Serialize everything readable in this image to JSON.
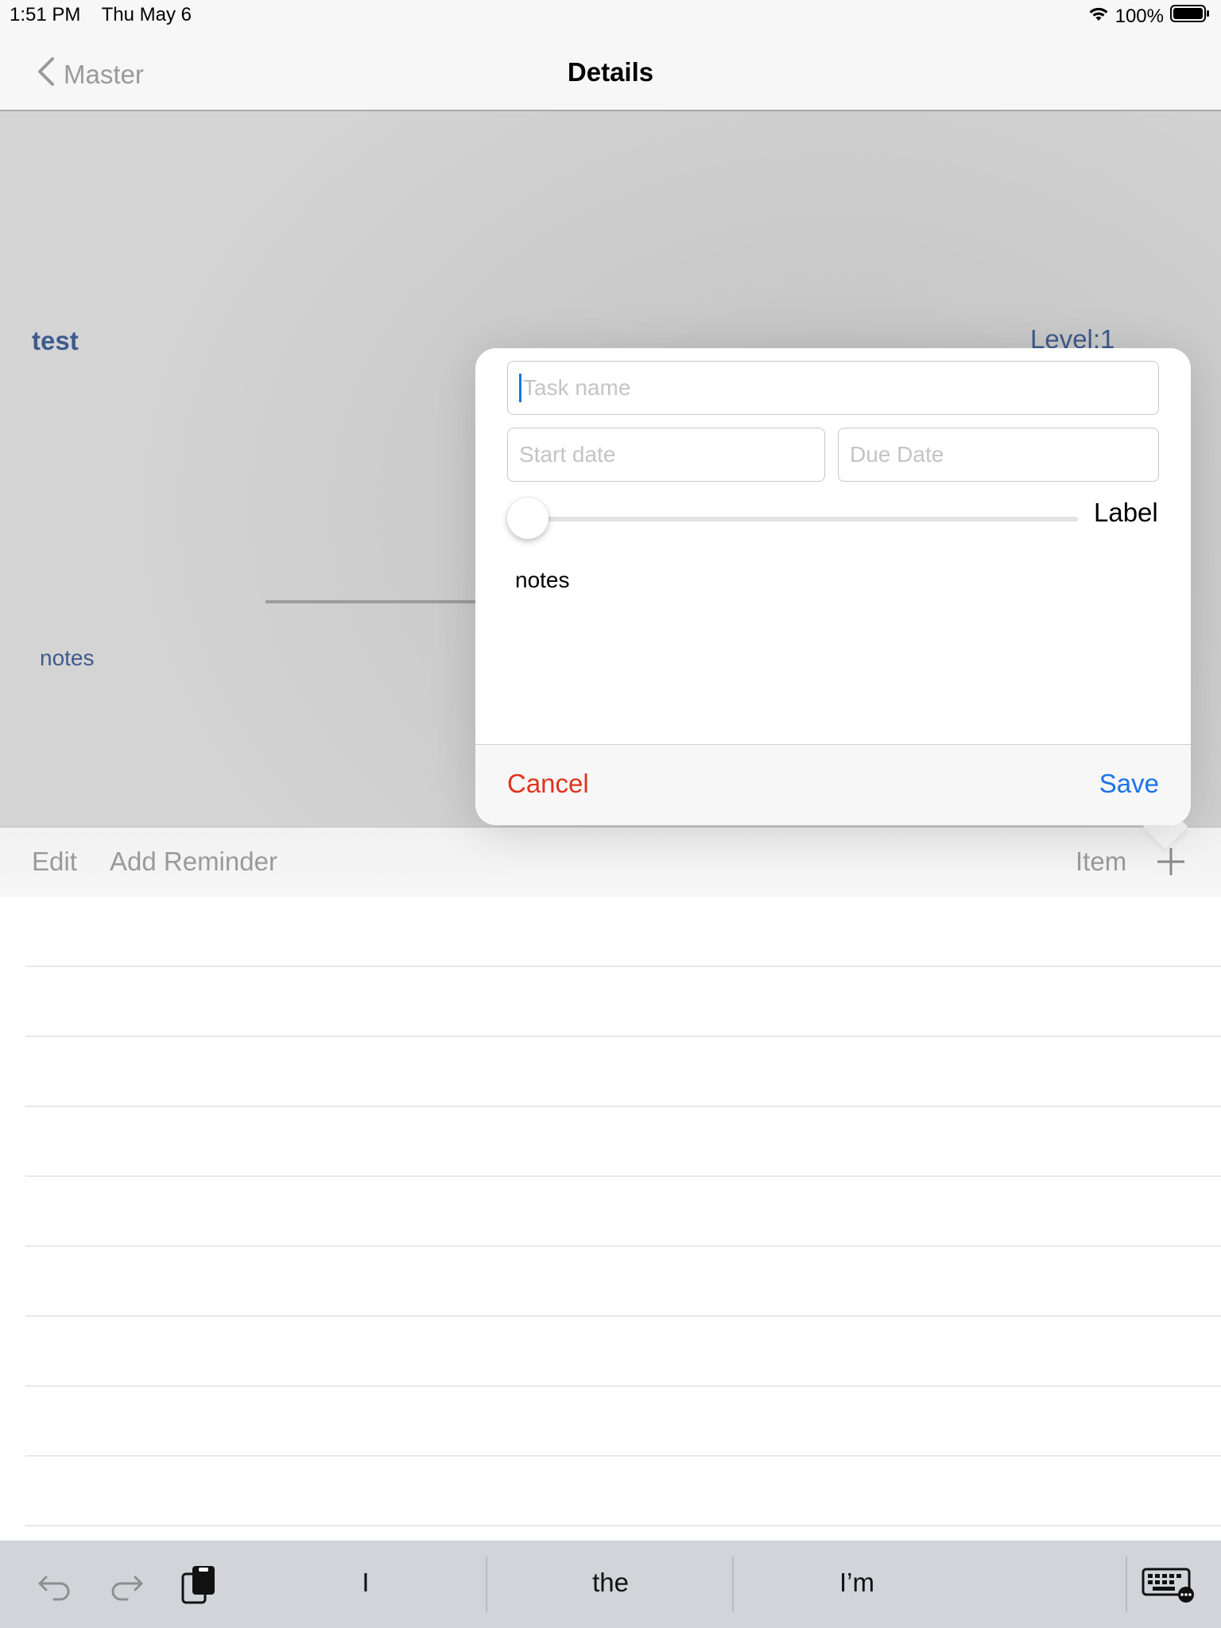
{
  "status_bar": {
    "time": "1:51 PM",
    "date": "Thu May 6",
    "battery": "100%",
    "icons": [
      "wifi-icon",
      "battery-icon"
    ]
  },
  "navbar": {
    "back_label": "Master",
    "title": "Details"
  },
  "detail": {
    "task_title": "test",
    "level": "Level:1",
    "notes": "notes"
  },
  "toolbar": {
    "edit_label": "Edit",
    "add_reminder_label": "Add Reminder",
    "item_label": "Item"
  },
  "popover": {
    "task_name_placeholder": "Task name",
    "start_date_placeholder": "Start date",
    "due_date_placeholder": "Due Date",
    "slider_label": "Label",
    "slider_value": 0,
    "notes_text": "notes",
    "cancel_label": "Cancel",
    "save_label": "Save"
  },
  "keyboard_bar": {
    "suggestions": [
      "I",
      "the",
      "I’m"
    ]
  },
  "colors": {
    "accent_blue": "#1a73e8",
    "cancel_red": "#e0341e",
    "detail_text": "#3f5a8c"
  }
}
